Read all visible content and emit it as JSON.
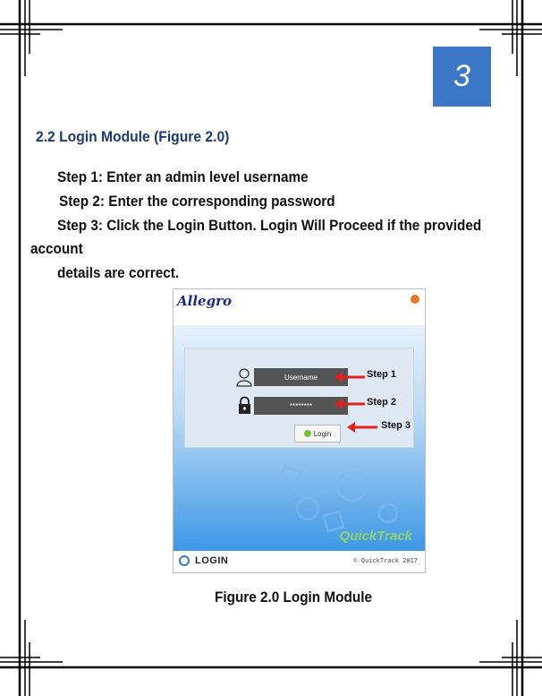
{
  "page_number": "3",
  "section_title": "2.2 Login Module (Figure 2.0)",
  "steps": {
    "step1": "Step 1: Enter an admin level username",
    "step2": "Step 2: Enter the corresponding password",
    "step3_line1": "Step 3: Click the Login Button. Login Will Proceed if the provided",
    "step3_line2": "account",
    "step3_line3": "details are correct."
  },
  "figure": {
    "brand_name": "Allegro",
    "username_placeholder": "Username",
    "password_masked": "********",
    "login_button": "Login",
    "step_labels": [
      "Step 1",
      "Step 2",
      "Step 3"
    ],
    "product_name": "QuickTrack",
    "footer_label": "LOGIN",
    "copyright": "© QuickTrack 2017"
  },
  "caption": "Figure 2.0 Login Module",
  "colors": {
    "accent": "#3b77c4",
    "title": "#1e3b6e",
    "arrow": "#e02020"
  }
}
